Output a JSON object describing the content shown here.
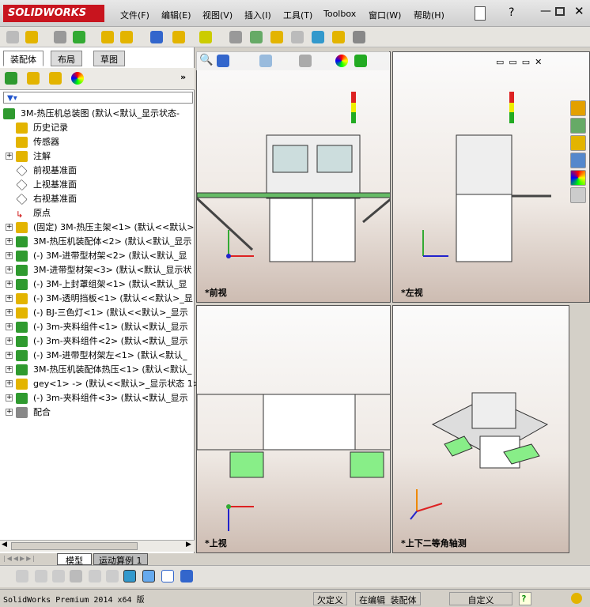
{
  "app": {
    "logo": "SOLIDWORKS"
  },
  "menu": [
    "文件(F)",
    "编辑(E)",
    "视图(V)",
    "插入(I)",
    "工具(T)",
    "Toolbox",
    "窗口(W)",
    "帮助(H)"
  ],
  "left_tabs": [
    "装配体",
    "布局",
    "草图"
  ],
  "tree": [
    {
      "label": "3M-热压机总装图  (默认<默认_显示状态-",
      "icon": "assembly",
      "expand": false,
      "indent": 0
    },
    {
      "label": "历史记录",
      "icon": "history",
      "indent": 1
    },
    {
      "label": "传感器",
      "icon": "sensor",
      "indent": 1
    },
    {
      "label": "注解",
      "icon": "annotation",
      "expand": true,
      "indent": 1
    },
    {
      "label": "前视基准面",
      "icon": "plane",
      "indent": 1
    },
    {
      "label": "上视基准面",
      "icon": "plane",
      "indent": 1
    },
    {
      "label": "右视基准面",
      "icon": "plane",
      "indent": 1
    },
    {
      "label": "原点",
      "icon": "origin",
      "indent": 1
    },
    {
      "label": "(固定) 3M-热压主架<1> (默认<<默认>",
      "icon": "part",
      "expand": true,
      "indent": 1
    },
    {
      "label": "3M-热压机装配体<2> (默认<默认_显示",
      "icon": "assembly",
      "expand": true,
      "indent": 1
    },
    {
      "label": "(-) 3M-进带型材架<2> (默认<默认_显",
      "icon": "assembly",
      "expand": true,
      "indent": 1
    },
    {
      "label": "3M-进带型材架<3> (默认<默认_显示状",
      "icon": "assembly",
      "expand": true,
      "indent": 1
    },
    {
      "label": "(-) 3M-上封罩组架<1> (默认<默认_显",
      "icon": "assembly",
      "expand": true,
      "indent": 1
    },
    {
      "label": "(-) 3M-透明挡板<1> (默认<<默认>_显",
      "icon": "part",
      "expand": true,
      "indent": 1
    },
    {
      "label": "(-) BJ-三色灯<1> (默认<<默认>_显示",
      "icon": "part",
      "expand": true,
      "indent": 1
    },
    {
      "label": "(-) 3m-夹料组件<1> (默认<默认_显示",
      "icon": "assembly",
      "expand": true,
      "indent": 1
    },
    {
      "label": "(-) 3m-夹料组件<2> (默认<默认_显示",
      "icon": "assembly",
      "expand": true,
      "indent": 1
    },
    {
      "label": "(-) 3M-进带型材架左<1> (默认<默认_",
      "icon": "assembly",
      "expand": true,
      "indent": 1
    },
    {
      "label": "3M-热压机装配体热压<1> (默认<默认_",
      "icon": "assembly",
      "expand": true,
      "indent": 1
    },
    {
      "label": "gey<1> -> (默认<<默认>_显示状态 1>",
      "icon": "part",
      "expand": true,
      "indent": 1
    },
    {
      "label": "(-) 3m-夹料组件<3> (默认<默认_显示",
      "icon": "assembly",
      "expand": true,
      "indent": 1
    },
    {
      "label": "配合",
      "icon": "mates",
      "expand": true,
      "indent": 1
    }
  ],
  "viewports": [
    {
      "label": "*前视"
    },
    {
      "label": "*左视"
    },
    {
      "label": "*上视"
    },
    {
      "label": "*上下二等角轴测"
    }
  ],
  "bottom_tabs": [
    "模型",
    "运动算例 1"
  ],
  "status": {
    "product": "SolidWorks Premium 2014 x64 版",
    "state": "欠定义",
    "mode": "在编辑 装配体",
    "units": "自定义",
    "help": "?"
  },
  "colors": {
    "accent": "#c8141e",
    "part": "#e3b400",
    "assembly": "#2f9a2f"
  }
}
